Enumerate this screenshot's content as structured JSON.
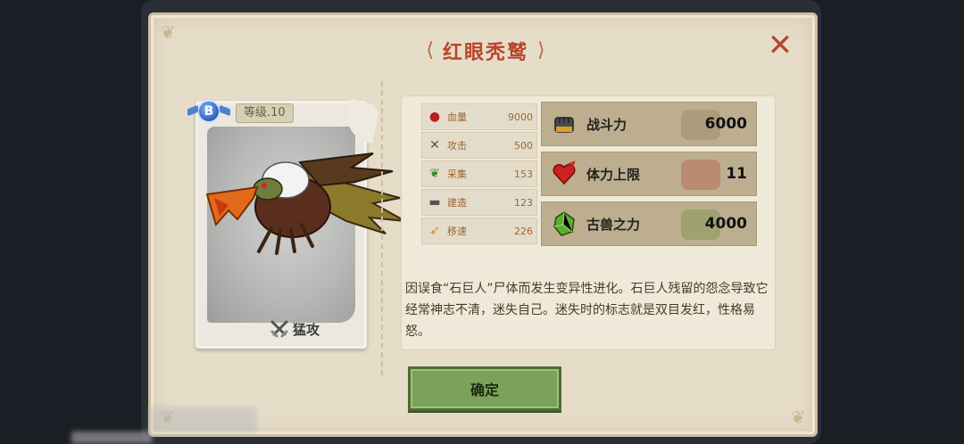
{
  "dialog": {
    "title": "红眼秃鹫",
    "close_icon": "close-x-icon"
  },
  "card": {
    "rank": "B",
    "level": "等级.10",
    "skill_label": "猛攻",
    "skill_icon": "crossed-swords-icon"
  },
  "mini_stats": [
    {
      "icon": "blood-drop-icon",
      "label": "血量",
      "value": "9000"
    },
    {
      "icon": "crossed-swords-icon",
      "label": "攻击",
      "value": "500"
    },
    {
      "icon": "leaf-icon",
      "label": "采集",
      "value": "153"
    },
    {
      "icon": "anvil-icon",
      "label": "建造",
      "value": "123"
    },
    {
      "icon": "winged-boot-icon",
      "label": "移速",
      "value": "226"
    }
  ],
  "big_stats": [
    {
      "icon": "fist-icon",
      "label": "战斗力",
      "value": "6000"
    },
    {
      "icon": "heart-icon",
      "label": "体力上限",
      "value": "11"
    },
    {
      "icon": "green-crystal-icon",
      "label": "古兽之力",
      "value": "4000"
    }
  ],
  "description": "因误食“石巨人”尸体而发生变异性进化。石巨人残留的怨念导致它经常神志不清，迷失自己。迷失时的标志就是双目发红，性格易怒。",
  "confirm_label": "确定",
  "colors": {
    "title": "#b8452a",
    "confirm_button": "#7ba25a",
    "panel": "#e6ddc9"
  }
}
